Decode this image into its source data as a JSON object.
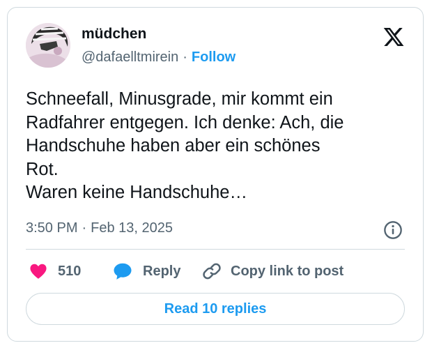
{
  "author": {
    "display_name": "müdchen",
    "handle": "@dafaelltmirein",
    "separator": "·",
    "follow_label": "Follow"
  },
  "tweet": {
    "lines": [
      "Schneefall, Minusgrade, mir kommt ein",
      "Radfahrer entgegen. Ich denke: Ach, die",
      "Handschuhe haben aber ein schönes",
      "Rot.",
      "Waren keine Handschuhe…"
    ],
    "time": "3:50 PM",
    "separator": "·",
    "date": "Feb 13, 2025"
  },
  "actions": {
    "like_count": "510",
    "reply_label": "Reply",
    "copy_link_label": "Copy link to post"
  },
  "read_replies_label": "Read 10 replies",
  "icons": {
    "logo": "x-logo-icon",
    "info": "info-icon",
    "like": "heart-icon",
    "reply": "speech-bubble-icon",
    "copy": "link-icon"
  },
  "colors": {
    "accent": "#1d9bf0",
    "like": "#f91880",
    "text": "#0f1419",
    "secondary": "#536471",
    "border": "#cfd9de"
  }
}
